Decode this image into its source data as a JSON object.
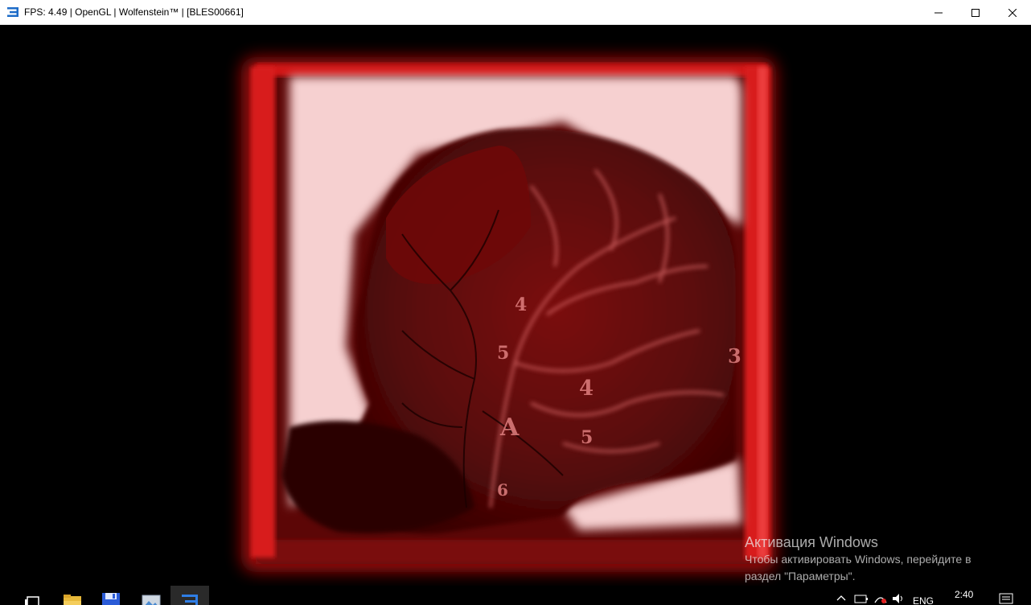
{
  "window": {
    "title": "FPS: 4.49 | OpenGL | Wolfenstein™ | [BLES00661]",
    "controls": [
      "minimize",
      "maximize",
      "close"
    ]
  },
  "scene": {
    "description_icon": "xray-skull-image",
    "film_markings": [
      "A",
      "4",
      "4",
      "5",
      "3",
      "5",
      "6"
    ]
  },
  "activation": {
    "title": "Активация Windows",
    "text": "Чтобы активировать Windows, перейдите в раздел \"Параметры\"."
  },
  "taskbar": {
    "items": [
      {
        "icon": "task-view-icon"
      },
      {
        "icon": "file-explorer-icon"
      },
      {
        "icon": "save-disk-icon"
      },
      {
        "icon": "image-viewer-icon"
      },
      {
        "icon": "rpcs3-icon"
      }
    ],
    "tray": {
      "language": "ENG",
      "time": "2:40"
    }
  },
  "colors": {
    "accent": "#1e6cc8",
    "xray_red": "#e01818"
  }
}
